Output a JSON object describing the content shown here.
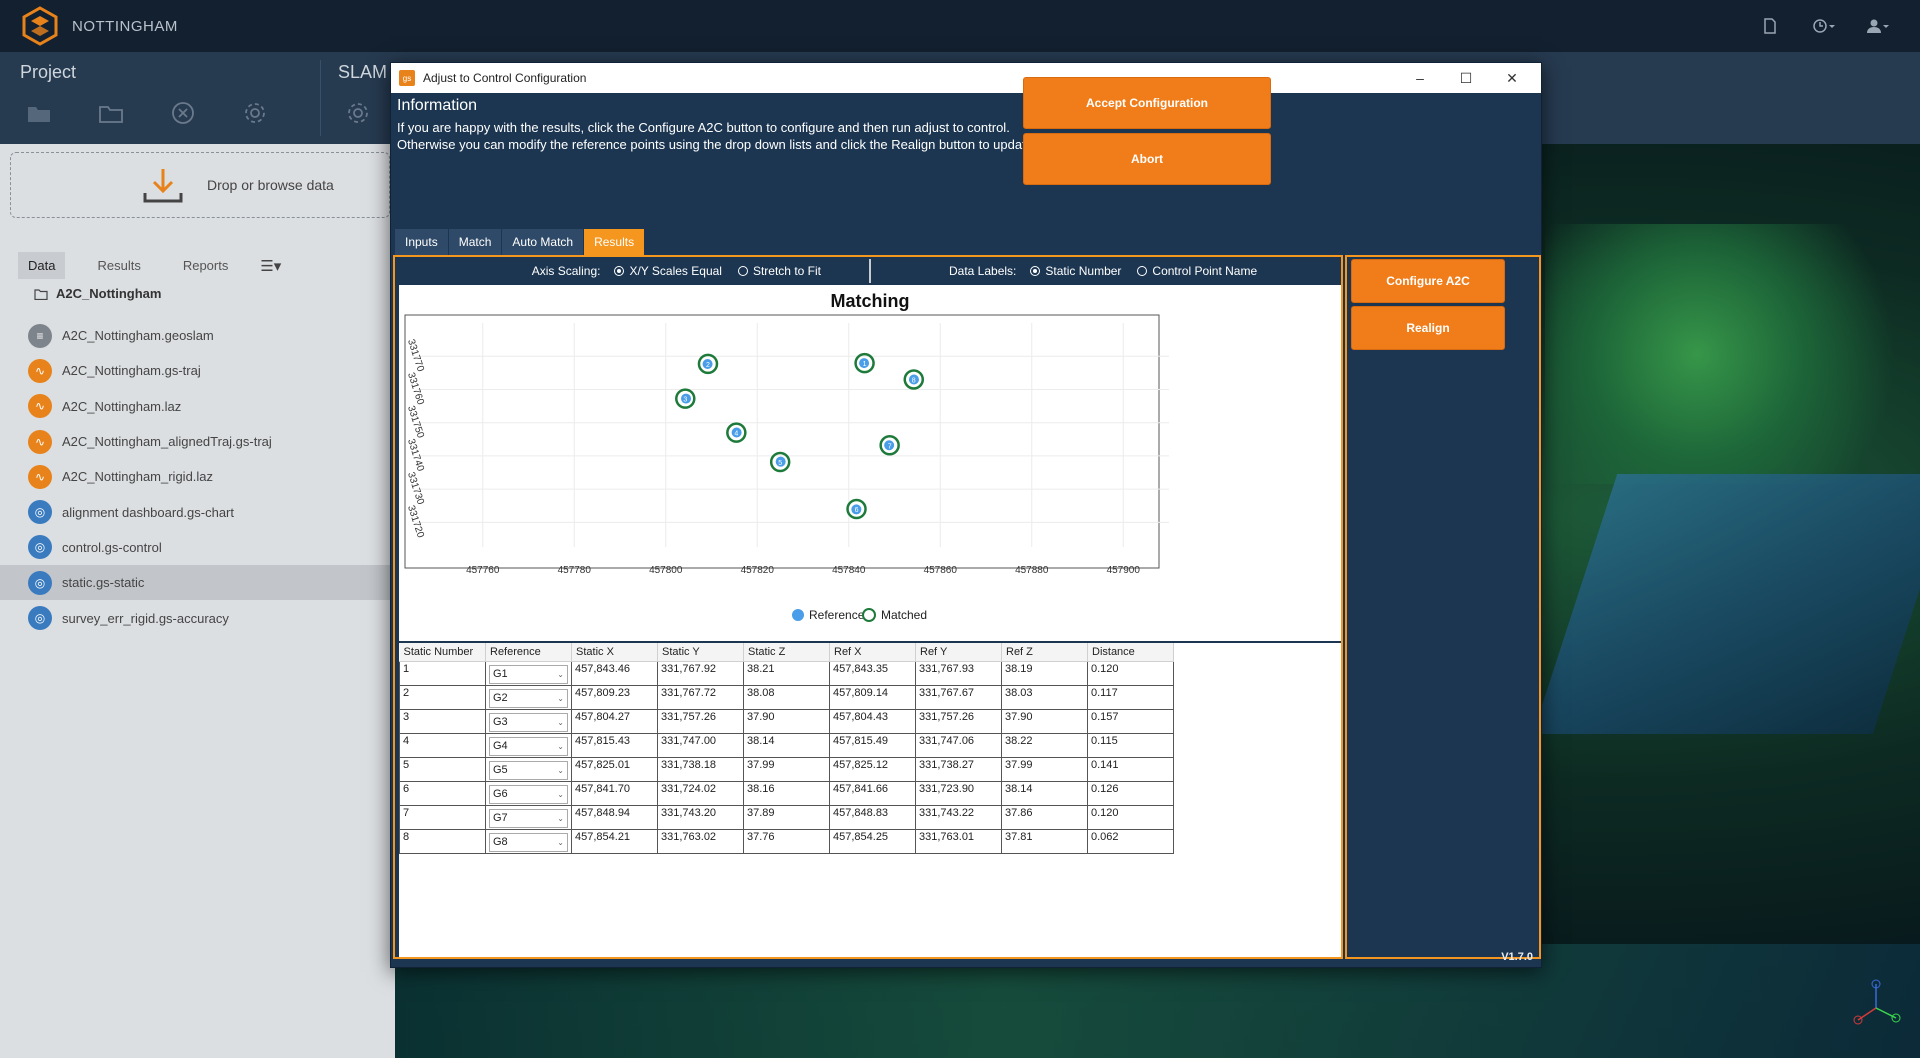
{
  "app": {
    "name": "NOTTINGHAM"
  },
  "toolbar": {
    "project_label": "Project",
    "slam_label": "SLAM"
  },
  "left": {
    "drop_text": "Drop or browse data",
    "tabs": [
      "Data",
      "Results",
      "Reports"
    ],
    "folder": "A2C_Nottingham",
    "files": [
      {
        "name": "A2C_Nottingham.geoslam",
        "kind": "grey"
      },
      {
        "name": "A2C_Nottingham.gs-traj",
        "kind": "orange"
      },
      {
        "name": "A2C_Nottingham.laz",
        "kind": "orange"
      },
      {
        "name": "A2C_Nottingham_alignedTraj.gs-traj",
        "kind": "orange"
      },
      {
        "name": "A2C_Nottingham_rigid.laz",
        "kind": "orange"
      },
      {
        "name": "alignment dashboard.gs-chart",
        "kind": "blue"
      },
      {
        "name": "control.gs-control",
        "kind": "blue"
      },
      {
        "name": "static.gs-static",
        "kind": "blue"
      },
      {
        "name": "survey_err_rigid.gs-accuracy",
        "kind": "blue"
      }
    ],
    "selected_index": 7
  },
  "dialog": {
    "title": "Adjust to Control Configuration",
    "info_title": "Information",
    "info_line1": "If you are happy with the results, click the Configure A2C button to configure and then run adjust to control.",
    "info_line2": "Otherwise you can modify the reference points using the drop down lists and click the Realign button to update the table and graph.",
    "accept_label": "Accept Configuration",
    "abort_label": "Abort",
    "tabs": [
      "Inputs",
      "Match",
      "Auto Match",
      "Results"
    ],
    "active_tab": "Results",
    "axis_scaling_label": "Axis Scaling:",
    "axis_scaling_opt1": "X/Y Scales Equal",
    "axis_scaling_opt2": "Stretch to Fit",
    "data_labels_label": "Data Labels:",
    "data_labels_opt1": "Static Number",
    "data_labels_opt2": "Control Point Name",
    "configure_label": "Configure A2C",
    "realign_label": "Realign",
    "version": "V1.7.0"
  },
  "chart_data": {
    "type": "scatter",
    "title": "Matching",
    "xlim": [
      457750,
      457910
    ],
    "ylim": [
      331715,
      331777
    ],
    "x_ticks": [
      "457760",
      "457780",
      "457800",
      "457820",
      "457840",
      "457860",
      "457880",
      "457900"
    ],
    "y_ticks": [
      "331720",
      "331730",
      "331740",
      "331750",
      "331760",
      "331770"
    ],
    "legend": [
      "Reference",
      "Matched"
    ],
    "series": [
      {
        "name": "Reference",
        "points": [
          {
            "label": "1",
            "x": 457843.35,
            "y": 331767.93
          },
          {
            "label": "2",
            "x": 457809.14,
            "y": 331767.67
          },
          {
            "label": "3",
            "x": 457804.43,
            "y": 331757.26
          },
          {
            "label": "4",
            "x": 457815.49,
            "y": 331747.06
          },
          {
            "label": "5",
            "x": 457825.12,
            "y": 331738.27
          },
          {
            "label": "6",
            "x": 457841.66,
            "y": 331723.9
          },
          {
            "label": "7",
            "x": 457848.83,
            "y": 331743.22
          },
          {
            "label": "8",
            "x": 457854.25,
            "y": 331763.01
          }
        ]
      },
      {
        "name": "Matched",
        "points": [
          {
            "label": "1",
            "x": 457843.46,
            "y": 331767.92
          },
          {
            "label": "2",
            "x": 457809.23,
            "y": 331767.72
          },
          {
            "label": "3",
            "x": 457804.27,
            "y": 331757.26
          },
          {
            "label": "4",
            "x": 457815.43,
            "y": 331747.0
          },
          {
            "label": "5",
            "x": 457825.01,
            "y": 331738.18
          },
          {
            "label": "6",
            "x": 457841.7,
            "y": 331724.02
          },
          {
            "label": "7",
            "x": 457848.94,
            "y": 331743.2
          },
          {
            "label": "8",
            "x": 457854.21,
            "y": 331763.02
          }
        ]
      }
    ],
    "colors": {
      "reference": "#4a9de8",
      "matched": "#1e7a3a"
    }
  },
  "table": {
    "headers": [
      "Static Number",
      "Reference",
      "Static X",
      "Static Y",
      "Static Z",
      "Ref X",
      "Ref Y",
      "Ref Z",
      "Distance"
    ],
    "rows": [
      [
        "1",
        "G1",
        "457,843.46",
        "331,767.92",
        "38.21",
        "457,843.35",
        "331,767.93",
        "38.19",
        "0.120"
      ],
      [
        "2",
        "G2",
        "457,809.23",
        "331,767.72",
        "38.08",
        "457,809.14",
        "331,767.67",
        "38.03",
        "0.117"
      ],
      [
        "3",
        "G3",
        "457,804.27",
        "331,757.26",
        "37.90",
        "457,804.43",
        "331,757.26",
        "37.90",
        "0.157"
      ],
      [
        "4",
        "G4",
        "457,815.43",
        "331,747.00",
        "38.14",
        "457,815.49",
        "331,747.06",
        "38.22",
        "0.115"
      ],
      [
        "5",
        "G5",
        "457,825.01",
        "331,738.18",
        "37.99",
        "457,825.12",
        "331,738.27",
        "37.99",
        "0.141"
      ],
      [
        "6",
        "G6",
        "457,841.70",
        "331,724.02",
        "38.16",
        "457,841.66",
        "331,723.90",
        "38.14",
        "0.126"
      ],
      [
        "7",
        "G7",
        "457,848.94",
        "331,743.20",
        "37.89",
        "457,848.83",
        "331,743.22",
        "37.86",
        "0.120"
      ],
      [
        "8",
        "G8",
        "457,854.21",
        "331,763.02",
        "37.76",
        "457,854.25",
        "331,763.01",
        "37.81",
        "0.062"
      ]
    ]
  },
  "colors": {
    "accent": "#f5961e",
    "dialog_bg": "#1c3651"
  }
}
